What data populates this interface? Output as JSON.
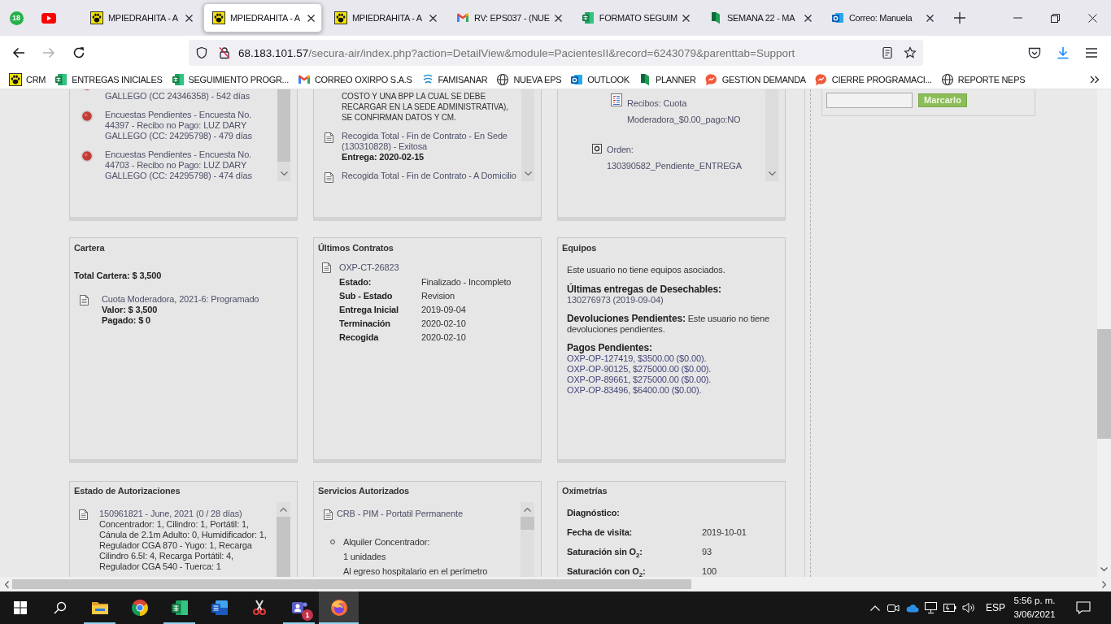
{
  "browser": {
    "pinned_tabs": [
      {
        "kind": "chat",
        "badge": "18"
      },
      {
        "kind": "video"
      }
    ],
    "tabs": [
      {
        "title": "MPIEDRAHITA - A",
        "kind": "paw",
        "selected": false
      },
      {
        "title": "MPIEDRAHITA - A",
        "kind": "paw",
        "selected": true
      },
      {
        "title": "MPIEDRAHITA - A",
        "kind": "paw",
        "selected": false
      },
      {
        "title": "RV: EPS037 - (NUE",
        "kind": "mail",
        "selected": false
      },
      {
        "title": "FORMATO SEGUIM",
        "kind": "sheet",
        "selected": false
      },
      {
        "title": "SEMANA 22 - MA",
        "kind": "planner",
        "selected": false
      },
      {
        "title": "Correo: Manuela",
        "kind": "outlook",
        "selected": false
      }
    ],
    "nav": [
      {
        "kind": "back",
        "disabled": false
      },
      {
        "kind": "forward",
        "disabled": true
      },
      {
        "kind": "reload",
        "disabled": false
      }
    ],
    "url": {
      "host": "68.183.101.57",
      "path": "/secura-air/index.php?action=DetailView&module=PacientesII&record=6243079&parenttab=Support"
    },
    "bookmarks": [
      {
        "label": "CRM",
        "kind": "paw"
      },
      {
        "label": "ENTREGAS INICIALES",
        "kind": "sheet"
      },
      {
        "label": "SEGUIMIENTO PROGR...",
        "kind": "sheet"
      },
      {
        "label": "CORREO OXIRPO S.A.S",
        "kind": "mail"
      },
      {
        "label": "FAMISANAR",
        "kind": "swirl"
      },
      {
        "label": "NUEVA EPS",
        "kind": "globe"
      },
      {
        "label": "OUTLOOK",
        "kind": "outlook"
      },
      {
        "label": "PLANNER",
        "kind": "planner"
      },
      {
        "label": "GESTION DEMANDA",
        "kind": "bubble"
      },
      {
        "label": "CIERRE PROGRAMACI...",
        "kind": "bubble"
      },
      {
        "label": "REPORTE NEPS",
        "kind": "globe"
      }
    ]
  },
  "top_panels": [
    {
      "items": [
        {
          "kind": "alert",
          "clipped": true,
          "text": "GALLEGO (CC 24346358) - 542 días"
        },
        {
          "kind": "alert",
          "clipped": false,
          "text": "Encuestas Pendientes - Encuesta No. 44397 - Recibo no Pago: LUZ DARY GALLEGO (CC: 24295798) - 479 días"
        },
        {
          "kind": "alert",
          "clipped": false,
          "text": "Encuestas Pendientes - Encuesta No. 44703 - Recibo no Pago: LUZ DARY GALLEGO (CC: 24295798) - 474 días"
        }
      ]
    },
    {
      "items": [
        {
          "kind": "note",
          "text": "COSTO Y UNA BPP LA CUAL SE DEBE RECARGAR EN LA SEDE ADMINISTRATIVA), SE CONFIRMAN DATOS Y CM."
        },
        {
          "kind": "record",
          "text": "Recogida Total - Fin de Contrato - En Sede (130310828) - Exitosa",
          "detail": "Entrega: 2020-02-15"
        },
        {
          "kind": "record",
          "text": "Recogida Total - Fin de Contrato - A Domicilio"
        }
      ]
    },
    {
      "items": [
        {
          "kind": "receipt",
          "text": "Recibos: Cuota Moderadora_$0.00_pago:NO"
        },
        {
          "kind": "order",
          "text": "Orden: 130390582_Pendiente_ENTREGA"
        }
      ]
    }
  ],
  "cartera": {
    "title": "Cartera",
    "total": "Total Cartera: $ 3,500",
    "items": [
      {
        "text": "Cuota Moderadora, 2021-6: Programado",
        "details": [
          "Valor: $ 3,500",
          "Pagado: $ 0"
        ]
      }
    ]
  },
  "contracts": {
    "title": "Últimos Contratos",
    "items": [
      {
        "code": "OXP-CT-26823",
        "fields": [
          {
            "label": "Estado:",
            "value": "Finalizado - Incompleto"
          },
          {
            "label": "Sub - Estado",
            "value": "Revision"
          },
          {
            "label": "Entrega Inicial",
            "value": "2019-09-04"
          },
          {
            "label": "Terminación",
            "value": "2020-02-10"
          },
          {
            "label": "Recogida",
            "value": "2020-02-10"
          }
        ]
      }
    ]
  },
  "equipment": {
    "title": "Equipos",
    "note": "Este usuario no tiene equipos asociados.",
    "disposables": {
      "label": "Últimas entregas de Desechables:",
      "lines": [
        "130276973 (2019-09-04)"
      ]
    },
    "returns": "**Devoluciones Pendientes:** Este usuario no tiene devoluciones pendientes.",
    "payments": {
      "label": "Pagos Pendientes:",
      "lines": [
        "OXP-OP-127419, $3500.00 ($0.00).",
        "OXP-OP-90125, $275000.00 ($0.00).",
        "OXP-OP-89661, $275000.00 ($0.00).",
        "OXP-OP-83496, $6400.00 ($0.00)."
      ]
    }
  },
  "authorizations": {
    "title": "Estado de Autorizaciones",
    "items": [
      {
        "link": "150961821 - June, 2021 (0 / 28 días)",
        "text": "Concentrador: 1, Cilindro: 1, Portátil: 1, Cánula de 2.1m Adulto: 0, Humidificador: 1, Regulador CGA 870 - Yugo: 1, Recarga Cilindro 6.5l: 4, Recarga Portátil: 4, Regulador CGA 540 - Tuerca: 1"
      }
    ]
  },
  "services": {
    "title": "Servicios Autorizados",
    "items": [
      {
        "link": "CRB - PIM - Portatil Permanente",
        "bullets": [
          {
            "text": "Alquiler Concentrador:",
            "lines": [
              "1 unidades",
              "Al egreso hospitalario en el perímetro"
            ]
          }
        ]
      }
    ]
  },
  "oximetry": {
    "title": "Oximetrías",
    "fields": [
      {
        "label": "Diagnóstico:"
      },
      {
        "label": "Fecha de visita:",
        "value": "2019-10-01"
      },
      {
        "label": "Saturación sin O$_{2}$:",
        "value": "93"
      },
      {
        "label": "Saturación con O$_{2}$:",
        "value": "100"
      }
    ]
  },
  "sidebar": {
    "button": "Marcarlo"
  },
  "taskbar": {
    "apps": [
      {
        "kind": "folder",
        "active": false,
        "running": true
      },
      {
        "kind": "ball",
        "active": false,
        "running": false
      },
      {
        "kind": "sheet",
        "active": false,
        "running": true
      },
      {
        "kind": "doc",
        "active": false,
        "running": false
      },
      {
        "kind": "scissors",
        "active": false,
        "running": false
      },
      {
        "kind": "people",
        "active": false,
        "running": true,
        "badge": "1"
      },
      {
        "kind": "flame",
        "active": true,
        "running": true
      }
    ],
    "language": "ESP",
    "time": "5:56 p. m.",
    "date": "3/06/2021"
  }
}
